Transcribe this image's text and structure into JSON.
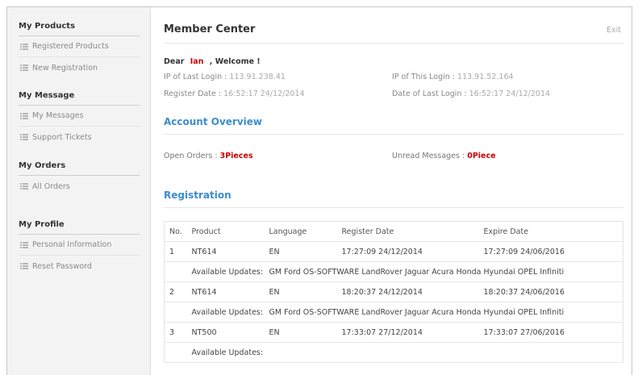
{
  "sidebar": {
    "sections": [
      {
        "title": "My Products",
        "items": [
          "Registered Products",
          "New Registration"
        ]
      },
      {
        "title": "My Message",
        "items": [
          "My Messages",
          "Support Tickets"
        ]
      },
      {
        "title": "My Orders",
        "items": [
          "All Orders"
        ]
      },
      {
        "title": "My Profile",
        "items": [
          "Personal Information",
          "Reset Password"
        ]
      }
    ]
  },
  "header": {
    "title": "Member Center",
    "exit_label": "Exit"
  },
  "welcome": {
    "prefix": "Dear",
    "name": "Ian",
    "suffix": ", Welcome !"
  },
  "login_info": {
    "last_ip_label": "IP of Last Login : ",
    "last_ip": "113.91.238.41",
    "this_ip_label": "IP of This Login : ",
    "this_ip": "113.91.52.164",
    "register_label": "Register Date  : ",
    "register_date": "16:52:17 24/12/2014",
    "last_login_label": "Date of Last Login : ",
    "last_login_date": "16:52:17 24/12/2014"
  },
  "overview": {
    "title": "Account Overview",
    "open_orders_label": "Open Orders : ",
    "open_orders_value": "3Pieces",
    "unread_label": "Unread Messages : ",
    "unread_value": "0Piece"
  },
  "registration": {
    "title": "Registration",
    "columns": [
      "No.",
      "Product",
      "Language",
      "Register Date",
      "Expire Date"
    ],
    "updates_label": "Available Updates:",
    "rows": [
      {
        "no": "1",
        "product": "NT614",
        "language": "EN",
        "register": "17:27:09 24/12/2014",
        "expire": "17:27:09 24/06/2016",
        "updates": "GM Ford OS-SOFTWARE LandRover Jaguar Acura Honda Hyundai OPEL Infiniti"
      },
      {
        "no": "2",
        "product": "NT614",
        "language": "EN",
        "register": "18:20:37 24/12/2014",
        "expire": "18:20:37 24/06/2016",
        "updates": "GM Ford OS-SOFTWARE LandRover Jaguar Acura Honda Hyundai OPEL Infiniti"
      },
      {
        "no": "3",
        "product": "NT500",
        "language": "EN",
        "register": "17:33:07 27/12/2014",
        "expire": "17:33:07 27/06/2016",
        "updates": ""
      }
    ]
  },
  "icons": {
    "sidebar_item": "list-icon"
  },
  "colors": {
    "accent": "#3b8ccd",
    "highlight": "#cc0000"
  }
}
